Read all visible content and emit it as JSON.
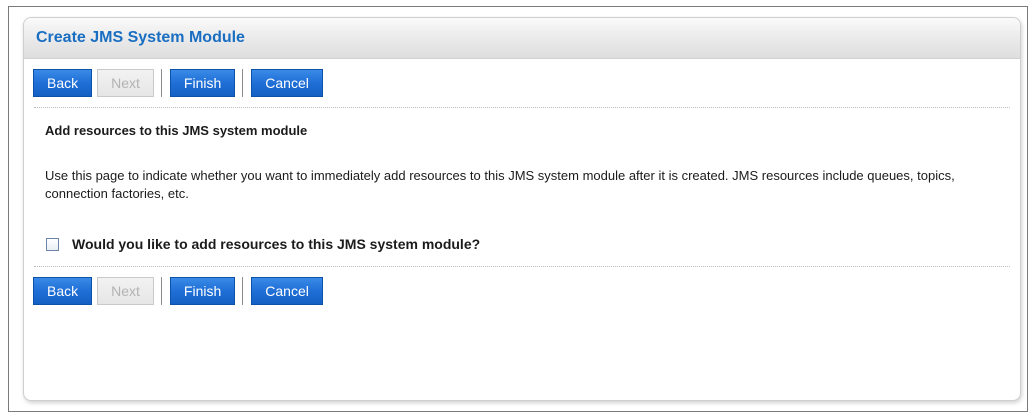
{
  "header": {
    "title": "Create JMS System Module"
  },
  "buttons": {
    "back": "Back",
    "next": "Next",
    "finish": "Finish",
    "cancel": "Cancel"
  },
  "content": {
    "heading": "Add resources to this JMS system module",
    "description": "Use this page to indicate whether you want to immediately add resources to this JMS system module after it is created. JMS resources include queues, topics, connection factories, etc.",
    "checkbox_label": "Would you like to add resources to this JMS system module?",
    "checkbox_checked": false
  },
  "colors": {
    "title": "#1a6ec2",
    "button_bg": "#1f6fd6",
    "button_text": "#ffffff",
    "disabled_text": "#b3b3b3"
  }
}
